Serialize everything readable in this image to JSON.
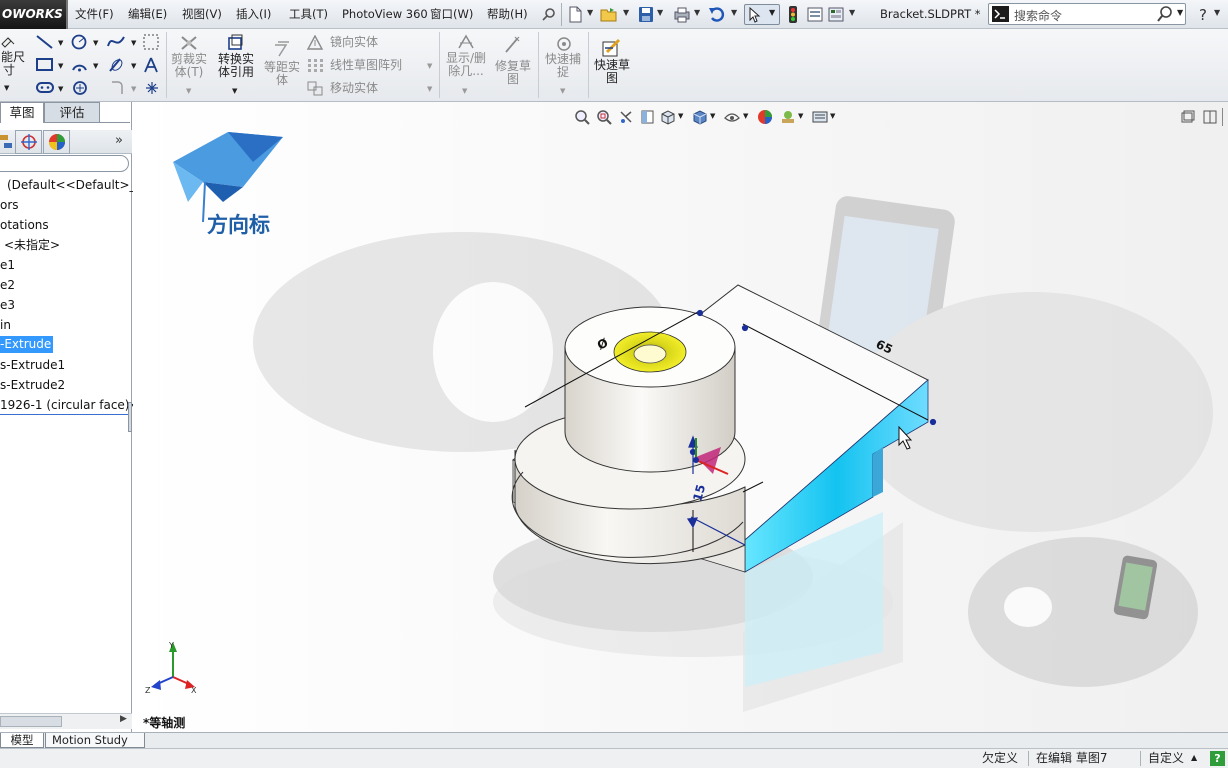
{
  "menubar": {
    "brand": "OWORKS",
    "items": [
      "文件(F)",
      "编辑(E)",
      "视图(V)",
      "插入(I)",
      "工具(T)",
      "PhotoView 360",
      "窗口(W)",
      "帮助(H)"
    ],
    "document_title": "Bracket.SLDPRT *",
    "search_placeholder": "搜索命令"
  },
  "ribbon": {
    "smart_dim_label_1": "能尺",
    "smart_dim_label_2": "寸",
    "trim_label_1": "剪裁实",
    "trim_label_2": "体(T)",
    "convert_label_1": "转换实",
    "convert_label_2": "体引用",
    "offset_label_1": "等距实",
    "offset_label_2": "体",
    "mirror_label": "镜向实体",
    "linear_pattern_label": "线性草图阵列",
    "move_label": "移动实体",
    "show_delete_label_1": "显示/删",
    "show_delete_label_2": "除几...",
    "repair_label_1": "修复草",
    "repair_label_2": "图",
    "quick_snap_label_1": "快速捕",
    "quick_snap_label_2": "捉",
    "rapid_sketch_label_1": "快速草",
    "rapid_sketch_label_2": "图"
  },
  "left_panel": {
    "tabs": [
      "草图",
      "评估"
    ],
    "tree_items": [
      "(Default<<Default>_D",
      "ors",
      "otations",
      "<未指定>",
      "e1",
      "e2",
      "e3",
      "in",
      "-Extrude",
      "s-Extrude1",
      "s-Extrude2",
      "1926-1 (circular face)<"
    ],
    "selected_index": 8
  },
  "viewport": {
    "logo_text": "方向标",
    "dim_diameter": "Ø",
    "dim_65": "65",
    "dim_15": "15",
    "view_name": "*等轴测",
    "triad_y": "Y",
    "triad_x": "X",
    "triad_z": "Z",
    "highlight_color": "#29c6f2",
    "accent_yellow": "#e8e21a"
  },
  "bottom_tabs": [
    "模型",
    "Motion Study 1"
  ],
  "status": {
    "definition": "欠定义",
    "editing": "在编辑 草图7",
    "custom": "自定义",
    "help": "?"
  }
}
